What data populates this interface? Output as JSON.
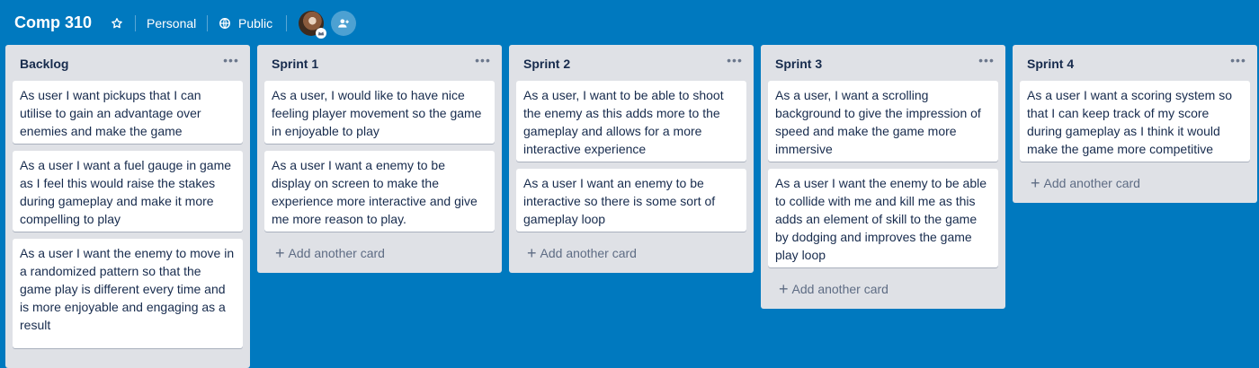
{
  "board": {
    "title": "Comp 310",
    "visibility_team": "Personal",
    "visibility": "Public"
  },
  "icons": {
    "star": "star-icon",
    "public": "globe-icon",
    "invite": "add-member-icon"
  },
  "colors": {
    "board_background": "#0079bf",
    "list_background": "#dfe1e6",
    "card_background": "#ffffff",
    "text_primary": "#172b4d",
    "text_muted": "#5e6c84"
  },
  "add_card_label": "Add another card",
  "lists": [
    {
      "title": "Backlog",
      "cards": [
        "As user I want pickups that I can utilise to gain an advantage over enemies and make the game",
        "As a user I want a fuel gauge in game as I feel this would raise the stakes during gameplay and make it more compelling to play",
        "As a user I want the enemy to move in a randomized pattern so that the game play is different every time and is more enjoyable and engaging as a result"
      ]
    },
    {
      "title": "Sprint 1",
      "cards": [
        "As a user, I would like to have nice feeling player movement so the game in enjoyable to play",
        "As a user I want a enemy to be display on screen to make the experience more interactive and give me more reason to play."
      ]
    },
    {
      "title": "Sprint 2",
      "cards": [
        "As a user, I want to be able to shoot the enemy as this adds more to the gameplay and allows for a more interactive experience",
        "As a user I want an enemy to be interactive so there is some sort of gameplay loop"
      ]
    },
    {
      "title": "Sprint 3",
      "cards": [
        "As a user, I want a scrolling background to give the impression of speed and make the game more immersive",
        "As a user I want the enemy to be able to collide with me and kill me as this adds an element of skill to the game by dodging and improves the game play loop"
      ]
    },
    {
      "title": "Sprint 4",
      "cards": [
        "As a user I want a scoring system so that I can keep track of my score during gameplay as I think it would make the game more competitive"
      ]
    }
  ]
}
